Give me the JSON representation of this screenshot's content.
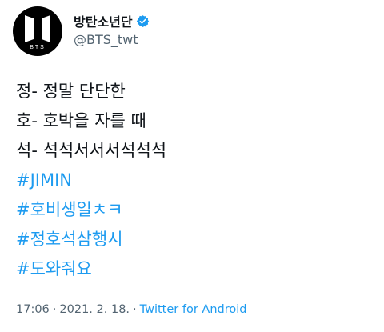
{
  "author": {
    "display_name": "방탄소년단",
    "handle": "@BTS_twt",
    "verified": true,
    "avatar_logo_text": "BTS"
  },
  "tweet": {
    "lines": [
      "정- 정말 단단한",
      "호- 호박을 자를 때",
      "석- 석석서서서석석석"
    ],
    "hashtags": [
      "#JIMIN",
      "#호비생일ㅊㅋ",
      "#정호석삼행시",
      "#도와줘요"
    ]
  },
  "meta": {
    "time": "17:06",
    "separator": "·",
    "date": "2021. 2. 18.",
    "source": "Twitter for Android"
  },
  "colors": {
    "link": "#1d9bf0",
    "secondary_text": "#536471",
    "primary_text": "#0f1419",
    "avatar_bg": "#000000"
  },
  "icons": {
    "verified": "verified-badge-icon",
    "avatar": "bts-logo-icon"
  }
}
